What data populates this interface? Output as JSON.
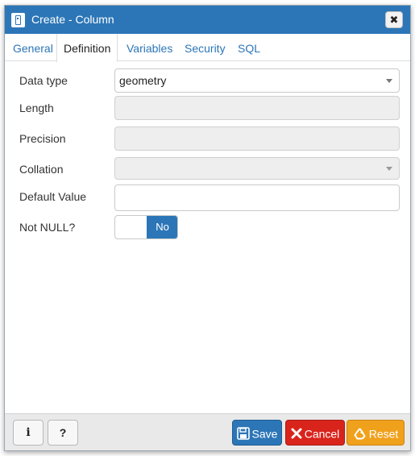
{
  "window": {
    "title": "Create - Column",
    "close_symbol": "✖"
  },
  "tabs": [
    {
      "label": "General"
    },
    {
      "label": "Definition",
      "active": true
    },
    {
      "label": "Variables"
    },
    {
      "label": "Security"
    },
    {
      "label": "SQL"
    }
  ],
  "form": {
    "data_type": {
      "label": "Data type",
      "value": "geometry"
    },
    "length": {
      "label": "Length",
      "value": ""
    },
    "precision": {
      "label": "Precision",
      "value": ""
    },
    "collation": {
      "label": "Collation",
      "value": ""
    },
    "default_value": {
      "label": "Default Value",
      "value": ""
    },
    "not_null": {
      "label": "Not NULL?",
      "state_label": "No"
    }
  },
  "footer": {
    "info_label": "i",
    "help_label": "?",
    "save_label": "Save",
    "cancel_label": "Cancel",
    "reset_label": "Reset"
  },
  "colors": {
    "accent": "#2c76b7",
    "danger": "#d9241c",
    "warning": "#f0a11c"
  },
  "icons": {
    "title": "column-icon",
    "save": "floppy-disk-icon",
    "cancel": "x-mark-icon",
    "reset": "recycle-icon"
  }
}
